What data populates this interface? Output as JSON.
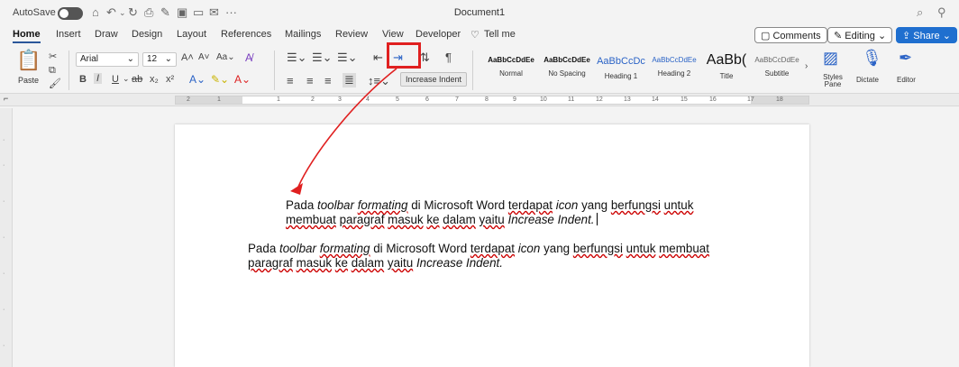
{
  "titlebar": {
    "autosave_label": "AutoSave",
    "document_title": "Document1",
    "qat_icons": [
      "home-icon",
      "undo-icon",
      "redo-icon",
      "print-icon",
      "format-painter-icon",
      "save-icon",
      "folder-icon",
      "mail-icon",
      "more-icon"
    ],
    "right_icons": [
      "search-icon",
      "share-people-icon"
    ]
  },
  "tabs": [
    "Home",
    "Insert",
    "Draw",
    "Design",
    "Layout",
    "References",
    "Mailings",
    "Review",
    "View",
    "Developer"
  ],
  "tell_me": "Tell me",
  "right_buttons": {
    "comments": "Comments",
    "editing": "Editing",
    "share": "Share"
  },
  "ribbon": {
    "paste_label": "Paste",
    "font_name": "Arial",
    "font_size": "12",
    "tooltip": "Increase Indent",
    "styles": [
      {
        "preview": "AaBbCcDdEe",
        "name": "Normal"
      },
      {
        "preview": "AaBbCcDdEe",
        "name": "No Spacing"
      },
      {
        "preview": "AaBbCcDc",
        "name": "Heading 1"
      },
      {
        "preview": "AaBbCcDdEe",
        "name": "Heading 2"
      },
      {
        "preview": "AaBb(",
        "name": "Title"
      },
      {
        "preview": "AaBbCcDdEe",
        "name": "Subtitle"
      }
    ],
    "styles_pane_label": "Styles\nPane",
    "dictate_label": "Dictate",
    "editor_label": "Editor"
  },
  "ruler_numbers": [
    "2",
    "1",
    "1",
    "2",
    "3",
    "4",
    "5",
    "6",
    "7",
    "8",
    "9",
    "10",
    "11",
    "12",
    "13",
    "14",
    "15",
    "16",
    "17",
    "18"
  ],
  "document": {
    "para1": {
      "t1": "Pada ",
      "t2": "toolbar",
      "t3": " ",
      "t4": "formating",
      "t5": " di Microsoft Word ",
      "t6": "terdapat",
      "t7": " ",
      "t8": "icon",
      "t9": " yang ",
      "t10": "berfungsi",
      "t11": " ",
      "t12": "untuk",
      "t13": "membuat",
      "t14": " ",
      "t15": "paragraf",
      "t16": " ",
      "t17": "masuk",
      "t18": " ",
      "t19": "ke",
      "t20": " ",
      "t21": "dalam",
      "t22": " ",
      "t23": "yaitu",
      "t24": " ",
      "t25": "Increase Indent."
    },
    "para2": {
      "t1": "Pada ",
      "t2": "toolbar",
      "t3": " ",
      "t4": "formating",
      "t5": " di Microsoft Word ",
      "t6": "terdapat",
      "t7": " ",
      "t8": "icon",
      "t9": " yang ",
      "t10": "berfungsi",
      "t11": " ",
      "t12": "untuk",
      "t13": " ",
      "t14": "membuat",
      "t15": "paragraf",
      "t16": " ",
      "t17": "masuk",
      "t18": " ",
      "t19": "ke",
      "t20": " ",
      "t21": "dalam",
      "t22": " ",
      "t23": "yaitu",
      "t24": " ",
      "t25": "Increase Indent."
    }
  },
  "annotation_color": "#e02020"
}
